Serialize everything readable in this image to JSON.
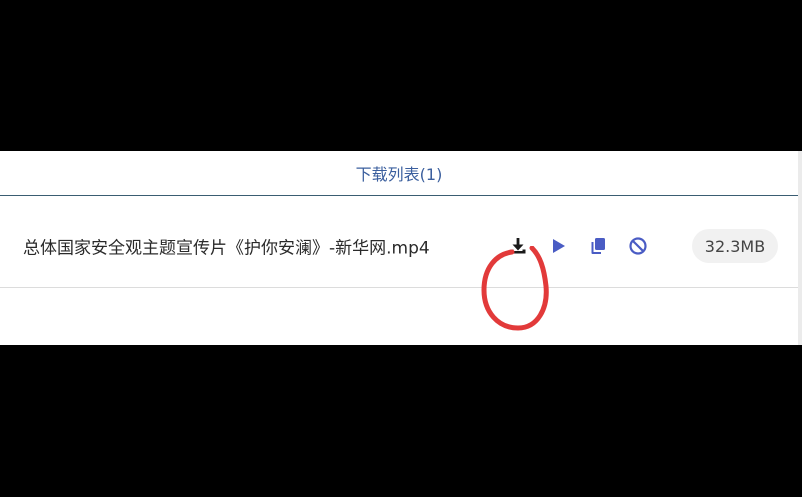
{
  "header": {
    "title": "下载列表(1)"
  },
  "downloads": [
    {
      "file_name": "总体国家安全观主题宣传片《护你安澜》-新华网.mp4",
      "size": "32.3MB",
      "actions": [
        {
          "icon": "download-icon"
        },
        {
          "icon": "play-icon"
        },
        {
          "icon": "copy-icon"
        },
        {
          "icon": "cancel-icon"
        }
      ]
    }
  ],
  "colors": {
    "accent": "#3b5f9e",
    "icon_blue": "#4a5cc4",
    "annotation_red": "#e23a3a"
  }
}
